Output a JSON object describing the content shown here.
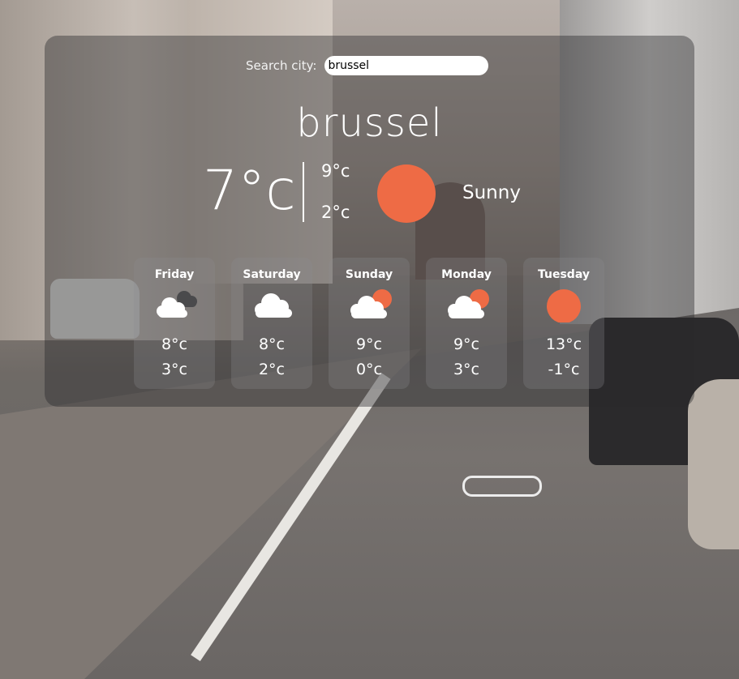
{
  "search": {
    "label": "Search city:",
    "value": "brussel"
  },
  "current": {
    "city": "brussel",
    "temp": "7°c",
    "high": "9°c",
    "low": "2°c",
    "condition": "Sunny",
    "icon": "sun-icon"
  },
  "forecast": [
    {
      "day": "Friday",
      "icon": "cloud-dark-cloud-icon",
      "high": "8°c",
      "low": "3°c"
    },
    {
      "day": "Saturday",
      "icon": "cloud-icon",
      "high": "8°c",
      "low": "2°c"
    },
    {
      "day": "Sunday",
      "icon": "sun-behind-cloud-icon",
      "high": "9°c",
      "low": "0°c"
    },
    {
      "day": "Monday",
      "icon": "sun-behind-cloud-icon",
      "high": "9°c",
      "low": "3°c"
    },
    {
      "day": "Tuesday",
      "icon": "sun-icon",
      "high": "13°c",
      "low": "-1°c"
    }
  ],
  "colors": {
    "sun": "#ee6b45",
    "cloud": "#ffffff",
    "dark_cloud": "#4a4a4c"
  }
}
